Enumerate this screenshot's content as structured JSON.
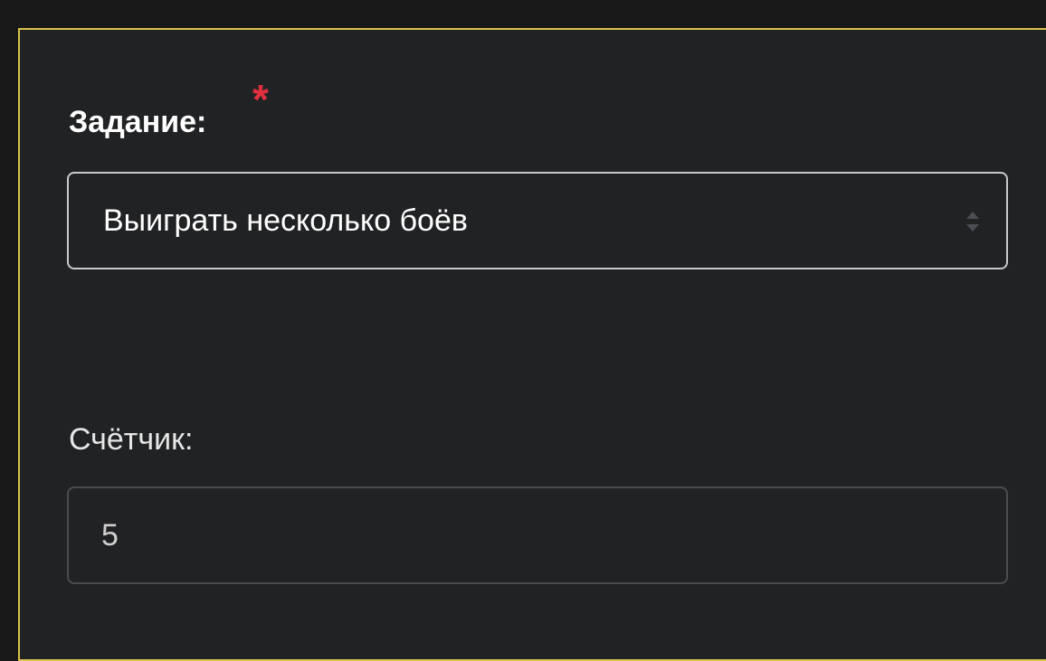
{
  "form": {
    "task_label": "Задание:",
    "required_marker": "*",
    "task_select": {
      "selected_value": "Выиграть несколько боёв",
      "icon": "sort-arrows-icon"
    },
    "counter_label": "Счётчик:",
    "counter_value": "5"
  },
  "colors": {
    "panel_border": "#d9c34a",
    "required": "#e0303f",
    "panel_background": "#212224"
  }
}
